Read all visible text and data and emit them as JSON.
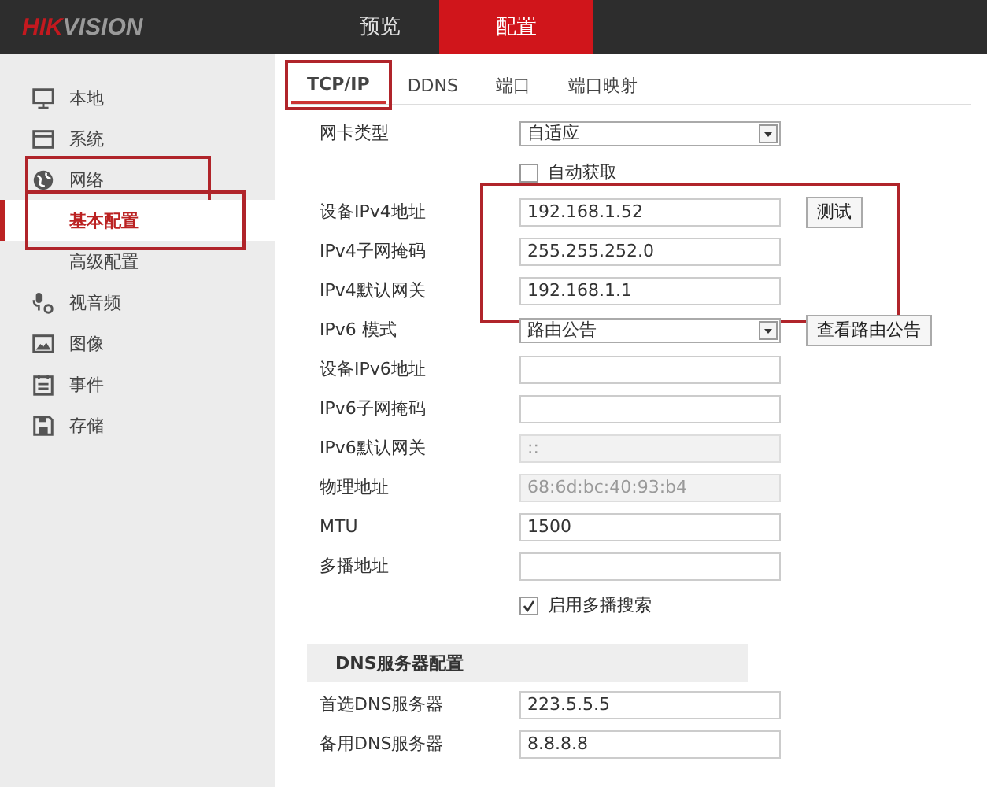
{
  "header": {
    "logo": {
      "part_1": "HIK",
      "part_2": "VISION"
    },
    "nav": [
      {
        "label": "预览",
        "selected": false
      },
      {
        "label": "配置",
        "selected": true
      }
    ]
  },
  "sidebar": {
    "items": [
      {
        "label": "本地",
        "selected": false,
        "highlighted": false
      },
      {
        "label": "系统",
        "selected": false,
        "highlighted": false
      },
      {
        "label": "网络",
        "selected": false,
        "highlighted": true,
        "children": [
          {
            "label": "基本配置",
            "selected": true,
            "highlighted": true
          },
          {
            "label": "高级配置",
            "selected": false,
            "highlighted": false
          }
        ]
      },
      {
        "label": "视音频",
        "selected": false,
        "highlighted": false
      },
      {
        "label": "图像",
        "selected": false,
        "highlighted": false
      },
      {
        "label": "事件",
        "selected": false,
        "highlighted": false
      },
      {
        "label": "存储",
        "selected": false,
        "highlighted": false
      }
    ]
  },
  "tabs": [
    {
      "label": "TCP/IP",
      "selected": true,
      "highlighted": true
    },
    {
      "label": "DDNS",
      "selected": false,
      "highlighted": false
    },
    {
      "label": "端口",
      "selected": false,
      "highlighted": false
    },
    {
      "label": "端口映射",
      "selected": false,
      "highlighted": false
    }
  ],
  "form": [
    {
      "rows": [
        {
          "kind": "select",
          "label": "网卡类型",
          "value": "自适应"
        },
        {
          "kind": "checkbox",
          "label": "自动获取",
          "checked": false
        }
      ]
    },
    {
      "highlighted": true,
      "rows": [
        {
          "kind": "text",
          "label": "设备IPv4地址",
          "value": "192.168.1.52",
          "button": "测试"
        },
        {
          "kind": "text",
          "label": "IPv4子网掩码",
          "value": "255.255.252.0"
        },
        {
          "kind": "text",
          "label": "IPv4默认网关",
          "value": "192.168.1.1"
        }
      ]
    },
    {
      "rows": [
        {
          "kind": "select",
          "label": "IPv6 模式",
          "value": "路由公告",
          "button": "查看路由公告"
        },
        {
          "kind": "text",
          "label": "设备IPv6地址"
        },
        {
          "kind": "text",
          "label": "IPv6子网掩码"
        },
        {
          "kind": "text",
          "label": "IPv6默认网关",
          "value": "::",
          "disabled": true
        },
        {
          "kind": "text",
          "label": "物理地址",
          "value": "68:6d:bc:40:93:b4",
          "disabled": true
        },
        {
          "kind": "text",
          "label": "MTU",
          "value": "1500",
          "disabled": false
        },
        {
          "kind": "text",
          "label": "多播地址"
        },
        {
          "kind": "checkbox",
          "label": "启用多播搜索",
          "checked": true
        }
      ]
    }
  ],
  "dns": {
    "title": "DNS服务器配置",
    "rows": [
      {
        "kind": "text",
        "label": "首选DNS服务器",
        "value": "223.5.5.5",
        "disabled": false
      },
      {
        "kind": "text",
        "label": "备用DNS服务器",
        "value": "8.8.8.8",
        "disabled": false
      }
    ]
  }
}
